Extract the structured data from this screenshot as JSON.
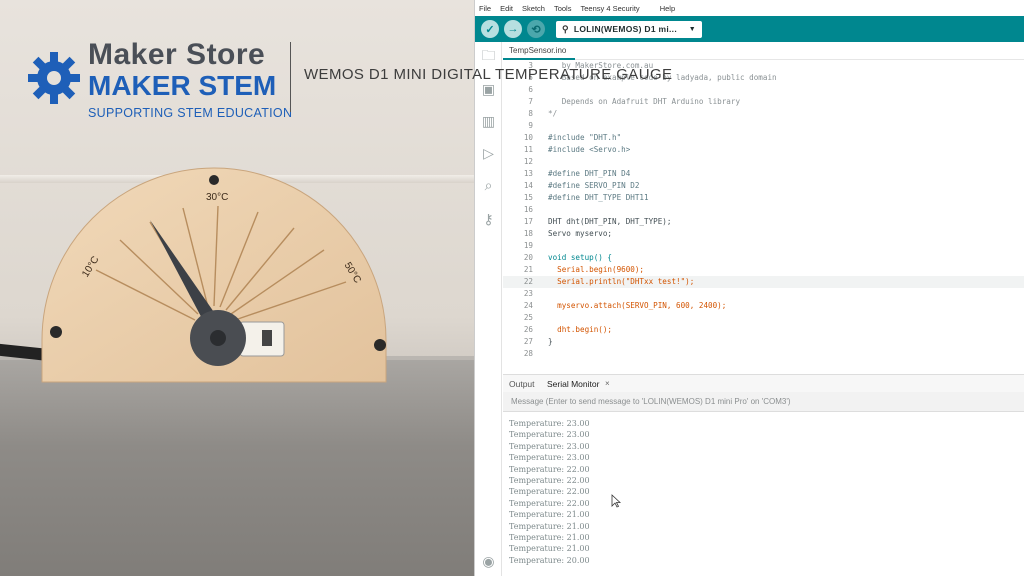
{
  "overlay": {
    "brand_top": "Maker Store",
    "brand_main": "MAKER STEM",
    "brand_tag": "SUPPORTING STEM EDUCATION",
    "video_title": "WEMOS D1 MINI DIGITAL TEMPERATURE GAUGE",
    "brand_color": "#1e5fb8"
  },
  "gauge": {
    "labels": [
      "10°C",
      "30°C",
      "50°C"
    ]
  },
  "ide": {
    "menu": [
      "File",
      "Edit",
      "Sketch",
      "Tools",
      "Teensy 4 Security",
      "Help"
    ],
    "toolbar": {
      "verify_icon": "check-icon",
      "upload_icon": "arrow-right-icon",
      "debug_icon": "debug-icon",
      "board": "LOLIN(WEMOS) D1 mi...",
      "accent": "#00878f"
    },
    "sidebar_icons": [
      "folder-icon",
      "board-icon",
      "library-icon",
      "debug-icon",
      "search-icon",
      "key-icon",
      "account-icon"
    ],
    "file_tab": "TempSensor.ino",
    "code": [
      {
        "n": "3",
        "text": "   by MakerStore.com.au",
        "cls": "c-comment"
      },
      {
        "n": "5",
        "text": "   Based on example code by ladyada, public domain",
        "cls": "c-comment"
      },
      {
        "n": "6",
        "text": "",
        "cls": "c-plain"
      },
      {
        "n": "7",
        "text": "   Depends on Adafruit DHT Arduino library",
        "cls": "c-comment"
      },
      {
        "n": "8",
        "text": "*/",
        "cls": "c-comment"
      },
      {
        "n": "9",
        "text": "",
        "cls": "c-plain"
      },
      {
        "n": "10",
        "text": "#include \"DHT.h\"",
        "cls": "c-pre"
      },
      {
        "n": "11",
        "text": "#include <Servo.h>",
        "cls": "c-pre"
      },
      {
        "n": "12",
        "text": "",
        "cls": "c-plain"
      },
      {
        "n": "13",
        "text": "#define DHT_PIN D4",
        "cls": "c-pre"
      },
      {
        "n": "14",
        "text": "#define SERVO_PIN D2",
        "cls": "c-pre"
      },
      {
        "n": "15",
        "text": "#define DHT_TYPE DHT11",
        "cls": "c-pre"
      },
      {
        "n": "16",
        "text": "",
        "cls": "c-plain"
      },
      {
        "n": "17",
        "text": "DHT dht(DHT_PIN, DHT_TYPE);",
        "cls": "c-plain"
      },
      {
        "n": "18",
        "text": "Servo myservo;",
        "cls": "c-plain"
      },
      {
        "n": "19",
        "text": "",
        "cls": "c-plain"
      },
      {
        "n": "20",
        "text": "void setup() {",
        "cls": "c-kw"
      },
      {
        "n": "21",
        "text": "  Serial.begin(9600);",
        "cls": "c-fn"
      },
      {
        "n": "22",
        "text": "  Serial.println(\"DHTxx test!\");",
        "cls": "c-fn"
      },
      {
        "n": "23",
        "text": "",
        "cls": "c-plain"
      },
      {
        "n": "24",
        "text": "  myservo.attach(SERVO_PIN, 600, 2400);",
        "cls": "c-fn"
      },
      {
        "n": "25",
        "text": "",
        "cls": "c-plain"
      },
      {
        "n": "26",
        "text": "  dht.begin();",
        "cls": "c-fn"
      },
      {
        "n": "27",
        "text": "}",
        "cls": "c-plain"
      },
      {
        "n": "28",
        "text": "",
        "cls": "c-plain"
      }
    ],
    "highlighted_line": "22",
    "panel": {
      "output_tab": "Output",
      "serial_tab": "Serial Monitor",
      "close_glyph": "×",
      "message_placeholder": "Message (Enter to send message to 'LOLIN(WEMOS) D1 mini Pro' on 'COM3')"
    },
    "serial_output": [
      "Temperature: 23.00",
      "Temperature: 23.00",
      "Temperature: 23.00",
      "Temperature: 23.00",
      "Temperature: 22.00",
      "Temperature: 22.00",
      "Temperature: 22.00",
      "Temperature: 22.00",
      "Temperature: 21.00",
      "Temperature: 21.00",
      "Temperature: 21.00",
      "Temperature: 21.00",
      "Temperature: 20.00"
    ]
  }
}
